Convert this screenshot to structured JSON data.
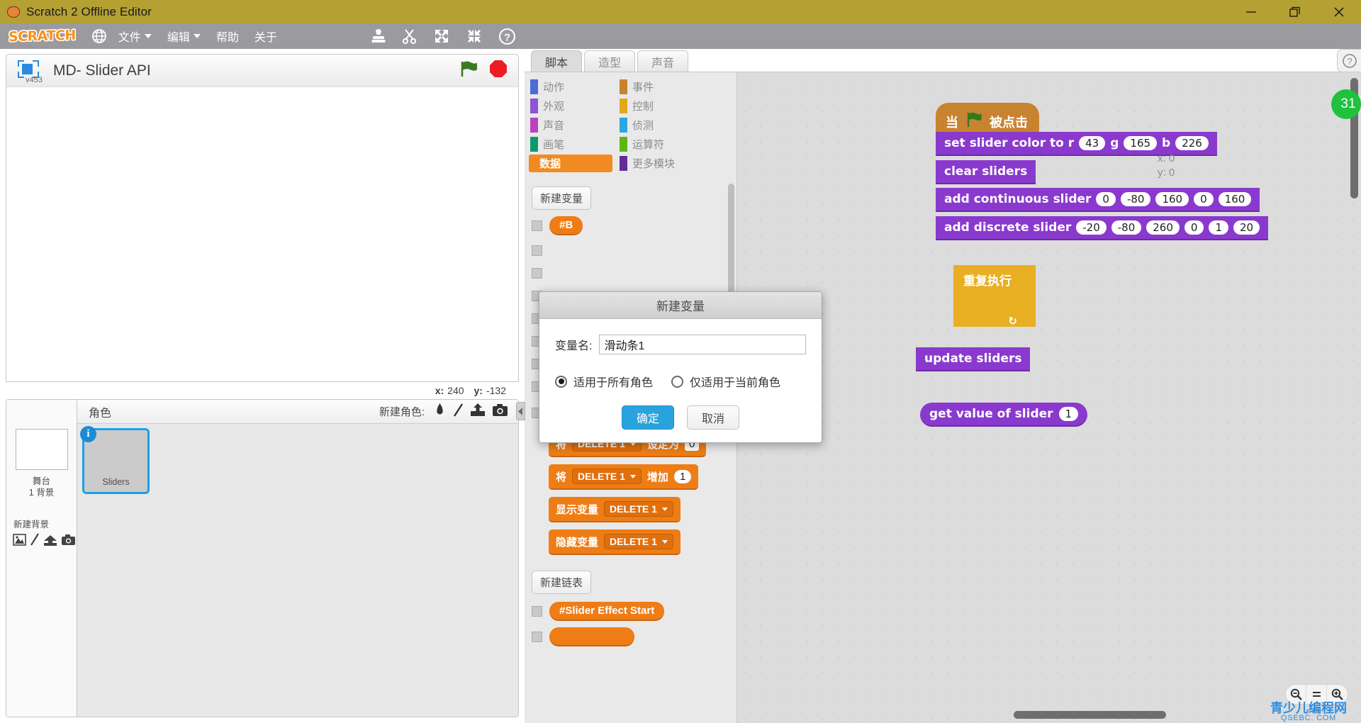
{
  "window": {
    "title": "Scratch 2 Offline Editor",
    "icon": "scratch-cat-icon",
    "minimize": "minimize-icon",
    "restore": "restore-icon",
    "close": "close-icon"
  },
  "menubar": {
    "logo": "SCRATCH",
    "globe_icon": "globe-icon",
    "items": [
      {
        "label": "文件",
        "has_caret": true
      },
      {
        "label": "编辑",
        "has_caret": true
      },
      {
        "label": "帮助",
        "has_caret": false
      },
      {
        "label": "关于",
        "has_caret": false
      }
    ],
    "tools": [
      "stamp-icon",
      "scissors-icon",
      "grow-icon",
      "shrink-icon",
      "help-icon"
    ]
  },
  "stage": {
    "project_title": "MD- Slider API",
    "version_label": "v453",
    "green_flag_icon": "green-flag-icon",
    "stop_icon": "stop-sign-icon",
    "mouse_x_label": "x:",
    "mouse_x_value": "240",
    "mouse_y_label": "y:",
    "mouse_y_value": "-132"
  },
  "sprite_pane": {
    "stage_label_line1": "舞台",
    "stage_label_line2": "1 背景",
    "new_backdrop_label": "新建背景",
    "backdrop_icons": [
      "picture-icon",
      "paint-icon",
      "upload-icon",
      "camera-icon"
    ],
    "sprites_header": "角色",
    "new_sprite_label": "新建角色:",
    "new_sprite_icons": [
      "choose-sprite-icon",
      "paint-icon",
      "upload-icon",
      "camera-icon"
    ],
    "sprites": [
      {
        "name": "Sliders",
        "selected": true,
        "info_badge": "i"
      }
    ]
  },
  "editor": {
    "tabs": [
      {
        "label": "脚本",
        "active": true
      },
      {
        "label": "造型",
        "active": false
      },
      {
        "label": "声音",
        "active": false
      }
    ],
    "categories": [
      {
        "label": "动作",
        "color": "#4a6cd4",
        "selected": false
      },
      {
        "label": "事件",
        "color": "#c88330",
        "selected": false
      },
      {
        "label": "外观",
        "color": "#8a55d7",
        "selected": false
      },
      {
        "label": "控制",
        "color": "#e1a91a",
        "selected": false
      },
      {
        "label": "声音",
        "color": "#bb42c3",
        "selected": false
      },
      {
        "label": "侦测",
        "color": "#2ca5e2",
        "selected": false
      },
      {
        "label": "画笔",
        "color": "#0e9a6c",
        "selected": false
      },
      {
        "label": "运算符",
        "color": "#5cb712",
        "selected": false
      },
      {
        "label": "数据",
        "color": "#ee7d16",
        "selected": true
      },
      {
        "label": "更多模块",
        "color": "#632d99",
        "selected": false
      }
    ],
    "palette": {
      "new_variable_button": "新建变量",
      "new_list_button": "新建链表",
      "variables": [
        {
          "name": "#B",
          "checked": false
        }
      ],
      "blocks": [
        {
          "type": "reporter",
          "name": "DELETE 1"
        },
        {
          "type": "set",
          "prefix": "将",
          "dropdown": "DELETE 1",
          "mid": "设定为",
          "value": "0"
        },
        {
          "type": "change",
          "prefix": "将",
          "dropdown": "DELETE 1",
          "mid": "增加",
          "value": "1"
        },
        {
          "type": "show",
          "prefix": "显示变量",
          "dropdown": "DELETE 1"
        },
        {
          "type": "hide",
          "prefix": "隐藏变量",
          "dropdown": "DELETE 1"
        }
      ],
      "lists": [
        {
          "name": "#Slider Effect Start",
          "checked": false
        }
      ]
    },
    "scripts": {
      "hat": {
        "pre": "当",
        "icon": "green-flag-icon",
        "post": "被点击"
      },
      "blocks": [
        {
          "label_parts": [
            "set slider color to r",
            "g",
            "b"
          ],
          "inputs": [
            "43",
            "165",
            "226"
          ]
        },
        {
          "label_parts": [
            "clear sliders"
          ],
          "inputs": []
        },
        {
          "label_parts": [
            "add continuous slider"
          ],
          "inputs": [
            "0",
            "-80",
            "160",
            "0",
            "160"
          ]
        },
        {
          "label_parts": [
            "add discrete slider"
          ],
          "inputs": [
            "-20",
            "-80",
            "260",
            "0",
            "1",
            "20"
          ]
        }
      ],
      "forever_block": "重复执行",
      "update_block": "update sliders",
      "get_value_block": {
        "label": "get value of slider",
        "input": "1"
      },
      "xy_readout_x": "x: 0",
      "xy_readout_y": "y: 0"
    },
    "zoom_controls": [
      "zoom-out-icon",
      "zoom-reset-icon",
      "zoom-in-icon"
    ],
    "help_button": "?",
    "green_badge": "31"
  },
  "dialog": {
    "title": "新建变量",
    "field_label": "变量名:",
    "field_value": "滑动条1",
    "field_placeholder": "",
    "radio_all": "适用于所有角色",
    "radio_this": "仅适用于当前角色",
    "radio_all_selected": true,
    "ok_button": "确定",
    "cancel_button": "取消"
  },
  "watermark": {
    "line1": "青少儿编程网",
    "line2": "QSEBC. COM"
  }
}
